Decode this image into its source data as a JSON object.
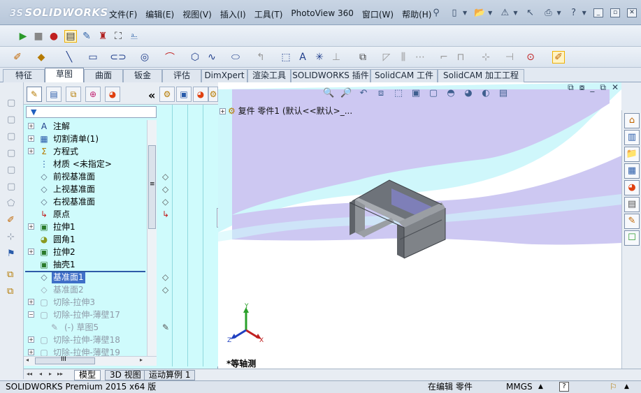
{
  "app": {
    "brand": "SOLIDWORKS",
    "brand_prefix": "3S"
  },
  "menu": [
    "文件(F)",
    "编辑(E)",
    "视图(V)",
    "插入(I)",
    "工具(T)",
    "PhotoView 360",
    "窗口(W)",
    "帮助(H)"
  ],
  "command_tabs": [
    "特征",
    "草图",
    "曲面",
    "钣金",
    "评估",
    "DimXpert",
    "渲染工具",
    "SOLIDWORKS 插件",
    "SolidCAM 工件",
    "SolidCAM 加工工程"
  ],
  "active_tab_index": 1,
  "tree": {
    "collapse_arrows": "«",
    "items": [
      {
        "label": "注解",
        "icon": "A",
        "expand": "+",
        "style": "normal"
      },
      {
        "label": "切割清单(1)",
        "icon": "▦",
        "expand": "+",
        "style": "normal"
      },
      {
        "label": "方程式",
        "icon": "Σ",
        "expand": "+",
        "style": "normal"
      },
      {
        "label": "材质 <未指定>",
        "icon": "⋮",
        "expand": "",
        "style": "normal"
      },
      {
        "label": "前视基准面",
        "icon": "◇",
        "expand": "",
        "style": "normal"
      },
      {
        "label": "上视基准面",
        "icon": "◇",
        "expand": "",
        "style": "normal"
      },
      {
        "label": "右视基准面",
        "icon": "◇",
        "expand": "",
        "style": "normal"
      },
      {
        "label": "原点",
        "icon": "↳",
        "expand": "",
        "style": "normal"
      },
      {
        "label": "拉伸1",
        "icon": "▣",
        "expand": "+",
        "style": "normal"
      },
      {
        "label": "圆角1",
        "icon": "◕",
        "expand": "",
        "style": "normal"
      },
      {
        "label": "拉伸2",
        "icon": "▣",
        "expand": "+",
        "style": "normal"
      },
      {
        "label": "抽壳1",
        "icon": "▣",
        "expand": "",
        "style": "normal"
      },
      {
        "label": "基准面1",
        "icon": "◇",
        "expand": "",
        "style": "selected"
      },
      {
        "label": "基准面2",
        "icon": "◇",
        "expand": "",
        "style": "dim"
      },
      {
        "label": "切除-拉伸3",
        "icon": "▢",
        "expand": "+",
        "style": "dim"
      },
      {
        "label": "切除-拉伸-薄壁17",
        "icon": "▢",
        "expand": "−",
        "style": "dim"
      },
      {
        "label": "(-) 草图5",
        "icon": "✎",
        "expand": "",
        "style": "dim"
      },
      {
        "label": "切除-拉伸-薄壁18",
        "icon": "▢",
        "expand": "+",
        "style": "dim"
      },
      {
        "label": "切除-拉伸-薄壁19",
        "icon": "▢",
        "expand": "+",
        "style": "dim"
      }
    ]
  },
  "scroll_grip": "≡",
  "hscroll_grip": "III",
  "viewport": {
    "tree_header": "复件 零件1 (默认<<默认>_...",
    "view_name": "*等轴测",
    "axis_labels": {
      "x": "X",
      "y": "Y",
      "z": "Z"
    }
  },
  "bottom_tabs": [
    "模型",
    "3D 视图",
    "运动算例 1"
  ],
  "active_bottom_tab": 0,
  "status": {
    "product": "SOLIDWORKS Premium 2015 x64 版",
    "editing": "在编辑 零件",
    "units": "MMGS",
    "help": "?"
  },
  "colors": {
    "tree_bg": "#cffbfc",
    "selection": "#3f6fc8",
    "graphics_bg": "#ffffff",
    "scene_band": "#cdc8f2",
    "scene_edge": "#cff7fb",
    "part": "#8f9398"
  }
}
